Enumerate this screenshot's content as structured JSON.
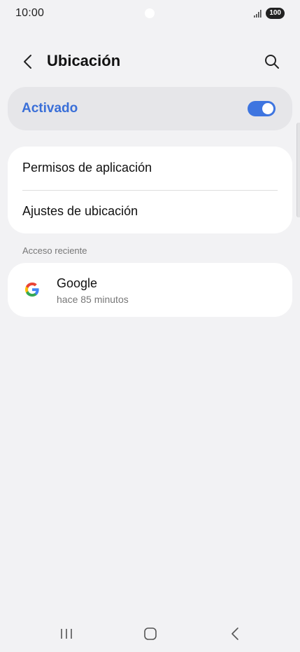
{
  "status_bar": {
    "time": "10:00",
    "battery": "100"
  },
  "header": {
    "title": "Ubicación",
    "back_icon": "chevron-left-icon",
    "search_icon": "search-icon"
  },
  "master_toggle": {
    "label": "Activado",
    "state": "on",
    "accent_color": "#3e75e0"
  },
  "settings": {
    "items": [
      {
        "label": "Permisos de aplicación"
      },
      {
        "label": "Ajustes de ubicación"
      }
    ]
  },
  "recent_access": {
    "header": "Acceso reciente",
    "items": [
      {
        "app": "Google",
        "time": "hace 85 minutos",
        "icon": "google-icon"
      }
    ]
  },
  "nav_bar": {
    "icons": [
      "recents-icon",
      "home-icon",
      "back-icon"
    ]
  }
}
